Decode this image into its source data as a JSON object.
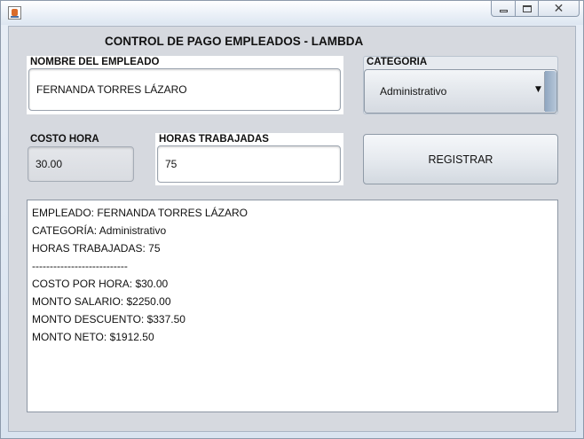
{
  "window": {
    "title": ""
  },
  "form": {
    "heading": "CONTROL DE PAGO EMPLEADOS - LAMBDA",
    "employee_name": {
      "label": "NOMBRE DEL EMPLEADO",
      "value": "FERNANDA TORRES LÁZARO"
    },
    "category": {
      "label": "CATEGORIA",
      "selected": "Administrativo"
    },
    "hourly_cost": {
      "label": "COSTO HORA",
      "value": "30.00"
    },
    "hours_worked": {
      "label": "HORAS TRABAJADAS",
      "value": "75"
    },
    "register_label": "REGISTRAR"
  },
  "output": {
    "lines": [
      "EMPLEADO: FERNANDA TORRES LÁZARO",
      "CATEGORÍA: Administrativo",
      "HORAS TRABAJADAS: 75",
      "---------------------------",
      "COSTO POR HORA: $30.00",
      "MONTO SALARIO: $2250.00",
      "MONTO DESCUENTO: $337.50",
      "MONTO NETO: $1912.50"
    ]
  }
}
